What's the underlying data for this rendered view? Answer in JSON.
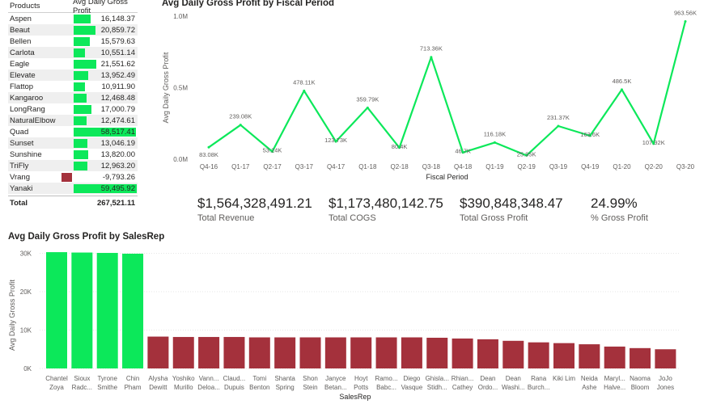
{
  "table": {
    "headers": [
      "Products",
      "Avg Daily Gross Profit"
    ],
    "rows": [
      {
        "name": "Aspen",
        "value": 16148.37,
        "label": "16,148.37"
      },
      {
        "name": "Beaut",
        "value": 20859.72,
        "label": "20,859.72"
      },
      {
        "name": "Bellen",
        "value": 15579.63,
        "label": "15,579.63"
      },
      {
        "name": "Carlota",
        "value": 10551.14,
        "label": "10,551.14"
      },
      {
        "name": "Eagle",
        "value": 21551.62,
        "label": "21,551.62"
      },
      {
        "name": "Elevate",
        "value": 13952.49,
        "label": "13,952.49"
      },
      {
        "name": "Flattop",
        "value": 10911.9,
        "label": "10,911.90"
      },
      {
        "name": "Kangaroo",
        "value": 12468.48,
        "label": "12,468.48"
      },
      {
        "name": "LongRang",
        "value": 17000.79,
        "label": "17,000.79"
      },
      {
        "name": "NaturalElbow",
        "value": 12474.61,
        "label": "12,474.61"
      },
      {
        "name": "Quad",
        "value": 58517.41,
        "label": "58,517.41"
      },
      {
        "name": "Sunset",
        "value": 13046.19,
        "label": "13,046.19"
      },
      {
        "name": "Sunshine",
        "value": 13820.0,
        "label": "13,820.00"
      },
      {
        "name": "TriFly",
        "value": 12963.2,
        "label": "12,963.20"
      },
      {
        "name": "Vrang",
        "value": -9793.26,
        "label": "-9,793.26"
      },
      {
        "name": "Yanaki",
        "value": 59495.92,
        "label": "59,495.92"
      }
    ],
    "total_label": "Total",
    "total_value": "267,521.11",
    "colors": {
      "positive": "#0ce85a",
      "negative": "#a4313c"
    }
  },
  "kpis": [
    {
      "value": "$1,564,328,491.21",
      "label": "Total Revenue"
    },
    {
      "value": "$1,173,480,142.75",
      "label": "Total COGS"
    },
    {
      "value": "$390,848,348.47",
      "label": "Total Gross Profit"
    },
    {
      "value": "24.99%",
      "label": "% Gross Profit"
    }
  ],
  "chart_data": [
    {
      "type": "line",
      "title": "Avg Daily Gross Profit by Fiscal Period",
      "xlabel": "Fiscal Period",
      "ylabel": "Avg Daily Gross Profit",
      "categories": [
        "Q4-16",
        "Q1-17",
        "Q2-17",
        "Q3-17",
        "Q4-17",
        "Q1-18",
        "Q2-18",
        "Q3-18",
        "Q4-18",
        "Q1-19",
        "Q2-19",
        "Q3-19",
        "Q4-19",
        "Q1-20",
        "Q2-20",
        "Q3-20"
      ],
      "values": [
        83080,
        239080,
        53240,
        478110,
        123730,
        359790,
        80400,
        713360,
        46700,
        116180,
        25950,
        231370,
        163600,
        486500,
        107920,
        963560
      ],
      "data_labels": [
        "83.08K",
        "239.08K",
        "53.24K",
        "478.11K",
        "123.73K",
        "359.79K",
        "80.4K",
        "713.36K",
        "46.7K",
        "116.18K",
        "25.95K",
        "231.37K",
        "163.6K",
        "486.5K",
        "107.92K",
        "963.56K"
      ],
      "yticks": [
        {
          "v": 0,
          "label": "0.0M"
        },
        {
          "v": 500000,
          "label": "0.5M"
        },
        {
          "v": 1000000,
          "label": "1.0M"
        }
      ],
      "ylim": [
        0,
        1000000
      ],
      "grid": false,
      "color": "#0ce85a"
    },
    {
      "type": "bar",
      "title": "Avg Daily Gross Profit by SalesRep",
      "xlabel": "SalesRep",
      "ylabel": "Avg Daily Gross Profit",
      "categories": [
        [
          "Chantel",
          "Zoya"
        ],
        [
          "Sioux",
          "Radc..."
        ],
        [
          "Tyrone",
          "Smithe"
        ],
        [
          "Chin",
          "Pham"
        ],
        [
          "Alysha",
          "Dewitt"
        ],
        [
          "Yoshiko",
          "Murillo"
        ],
        [
          "Vann...",
          "Deloa..."
        ],
        [
          "Claud...",
          "Dupuis"
        ],
        [
          "Tomi",
          "Benton"
        ],
        [
          "Shanta",
          "Spring"
        ],
        [
          "Shon",
          "Stein"
        ],
        [
          "Janyce",
          "Betan..."
        ],
        [
          "Hoyt",
          "Potts"
        ],
        [
          "Ramo...",
          "Babc..."
        ],
        [
          "Diego",
          "Vasque"
        ],
        [
          "Ghisla...",
          "Stidh..."
        ],
        [
          "Rhian...",
          "Cathey"
        ],
        [
          "Dean",
          "Ordo..."
        ],
        [
          "Dean",
          "Washi..."
        ],
        [
          "Rana",
          "Burch..."
        ],
        [
          "Kiki Lim",
          ""
        ],
        [
          "Neida",
          "Ashe"
        ],
        [
          "Maryl...",
          "Halve..."
        ],
        [
          "Naoma",
          "Bloom"
        ],
        [
          "JoJo",
          "Jones"
        ]
      ],
      "values": [
        30300,
        30200,
        30100,
        29900,
        8300,
        8200,
        8200,
        8200,
        8100,
        8100,
        8100,
        8100,
        8100,
        8100,
        8100,
        8000,
        7800,
        7600,
        7200,
        6800,
        6600,
        6300,
        5700,
        5300,
        5000
      ],
      "yticks": [
        {
          "v": 0,
          "label": "0K"
        },
        {
          "v": 10000,
          "label": "10K"
        },
        {
          "v": 20000,
          "label": "20K"
        },
        {
          "v": 30000,
          "label": "30K"
        }
      ],
      "ylim": [
        0,
        32000
      ],
      "grid": true,
      "colors": {
        "high": "#0ce85a",
        "low": "#a4313c"
      }
    }
  ]
}
